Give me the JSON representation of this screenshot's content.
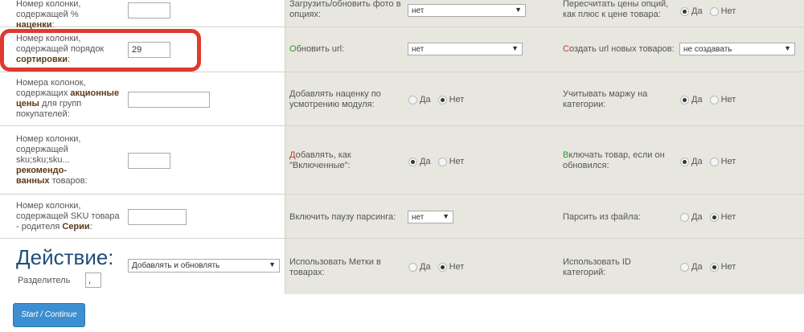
{
  "rows": {
    "markup_col": {
      "label_pre": "Номер колонки, содержащей % ",
      "label_bold": "наценки",
      "label_post": ":",
      "value": ""
    },
    "sort_col": {
      "label_pre": "Номер колонки, содержащей порядок ",
      "label_bold": "сортировки",
      "label_post": ":",
      "value": "29"
    },
    "promo_col": {
      "label_pre": "Номера колонок, содержащих ",
      "label_bold": "акционные цены",
      "label_post": " для групп покупателей:",
      "value": ""
    },
    "reco_col": {
      "label_pre": "Номер колонки, содержащей sku;sku;sku... ",
      "label_bold": "рекомендо-ванных",
      "label_post": " товаров:",
      "value": ""
    },
    "series_col": {
      "label_pre": "Номер колонки, содержащей SKU товара - родителя ",
      "label_bold": "Серии",
      "label_post": ":",
      "value": ""
    }
  },
  "options": {
    "upload_photo": {
      "label": "Загрузить/обновить фото в опциях:",
      "value": "нет"
    },
    "recalc_prices": {
      "label": "Пересчитать цены опций, как плюс к цене товара:",
      "yes": "Да",
      "no": "Нет",
      "selected": "yes"
    },
    "update_url": {
      "first": "О",
      "rest": "бновить url:",
      "value": "нет"
    },
    "create_url": {
      "first": "С",
      "rest": "оздать url новых товаров:",
      "value": "не создавать"
    },
    "add_markup": {
      "label": "Добавлять наценку по усмотрению модуля:",
      "yes": "Да",
      "no": "Нет",
      "selected": "no"
    },
    "category_margin": {
      "label": "Учитывать маржу на категории:",
      "yes": "Да",
      "no": "Нет",
      "selected": "yes"
    },
    "add_as_enabled": {
      "first": "Д",
      "rest": "обавлять, как \"Включенные\":",
      "yes": "Да",
      "no": "Нет",
      "selected": "yes"
    },
    "enable_if_updated": {
      "first": "В",
      "rest": "ключать товар, если он обновился:",
      "yes": "Да",
      "no": "Нет",
      "selected": "yes"
    },
    "parse_pause": {
      "label": "Включить паузу парсинга:",
      "value": "нет"
    },
    "parse_file": {
      "label": "Парсить из файла:",
      "yes": "Да",
      "no": "Нет",
      "selected": "no"
    },
    "use_tags": {
      "label": "Использовать Метки в товарах:",
      "yes": "Да",
      "no": "Нет",
      "selected": "no"
    },
    "use_cat_id": {
      "label": "Использовать ID категорий:",
      "yes": "Да",
      "no": "Нет",
      "selected": "no"
    }
  },
  "action": {
    "title": "Действие:",
    "value": "Добавлять и обновлять",
    "separator_label": "Разделитель",
    "separator_value": ","
  },
  "start_button": "Start / Continue",
  "colors": {
    "accent_red": "#e03a2f",
    "button_blue": "#3d8fd1",
    "title_blue": "#1f4d7a",
    "panel_bg": "#e7e6df"
  }
}
